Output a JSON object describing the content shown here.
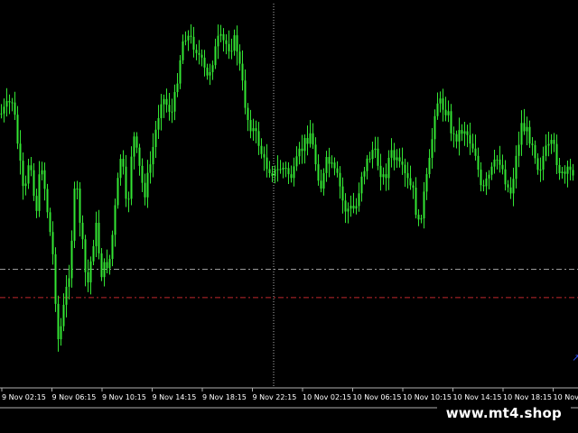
{
  "colors": {
    "background": "#000000",
    "candle_up": "#33e633",
    "candle_down": "#33e633",
    "crosshair": "#b0b0b0",
    "bid_line": "#9a9a9a",
    "support_line": "#c0282d",
    "axis": "#b0b0b0",
    "text": "#ffffff",
    "arrow_marker": "#3355ff"
  },
  "watermark": "www.mt4.shop",
  "chart_data": {
    "type": "candlestick",
    "x_tick_labels": [
      "9 Nov 02:15",
      "9 Nov 06:15",
      "9 Nov 10:15",
      "9 Nov 14:15",
      "9 Nov 18:15",
      "9 Nov 22:15",
      "10 Nov 02:15",
      "10 Nov 06:15",
      "10 Nov 10:15",
      "10 Nov 14:15",
      "10 Nov 18:15",
      "10 Nov"
    ],
    "close_path": [
      [
        0,
        25
      ],
      [
        4,
        21
      ],
      [
        8,
        50
      ],
      [
        10,
        35
      ],
      [
        12,
        54
      ],
      [
        14,
        38
      ],
      [
        18,
        65
      ],
      [
        20,
        90
      ],
      [
        24,
        68
      ],
      [
        26,
        43
      ],
      [
        30,
        75
      ],
      [
        33,
        56
      ],
      [
        35,
        70
      ],
      [
        38,
        66
      ],
      [
        42,
        35
      ],
      [
        44,
        55
      ],
      [
        46,
        30
      ],
      [
        50,
        48
      ],
      [
        52,
        40
      ],
      [
        56,
        20
      ],
      [
        60,
        25
      ],
      [
        62,
        12
      ],
      [
        64,
        2
      ],
      [
        68,
        6
      ],
      [
        72,
        15
      ],
      [
        76,
        4
      ],
      [
        80,
        6
      ],
      [
        82,
        4
      ],
      [
        86,
        26
      ],
      [
        90,
        33
      ],
      [
        92,
        39
      ],
      [
        96,
        42
      ],
      [
        98,
        40
      ],
      [
        102,
        43
      ],
      [
        104,
        37
      ],
      [
        108,
        30
      ],
      [
        110,
        39
      ],
      [
        112,
        46
      ],
      [
        114,
        38
      ],
      [
        118,
        44
      ],
      [
        120,
        52
      ],
      [
        124,
        52
      ],
      [
        126,
        42
      ],
      [
        130,
        35
      ],
      [
        134,
        44
      ],
      [
        136,
        36
      ],
      [
        140,
        41
      ],
      [
        144,
        47
      ],
      [
        146,
        57
      ],
      [
        150,
        38
      ],
      [
        152,
        21
      ],
      [
        156,
        24
      ],
      [
        158,
        32
      ],
      [
        162,
        29
      ],
      [
        166,
        36
      ],
      [
        168,
        48
      ],
      [
        170,
        44
      ],
      [
        174,
        37
      ],
      [
        178,
        48
      ],
      [
        182,
        28
      ],
      [
        186,
        33
      ],
      [
        188,
        41
      ],
      [
        190,
        36
      ],
      [
        193,
        34
      ],
      [
        196,
        43
      ],
      [
        200,
        41
      ]
    ],
    "reference_lines": [
      "bid",
      "support"
    ],
    "crosshair": true,
    "grid": false
  }
}
